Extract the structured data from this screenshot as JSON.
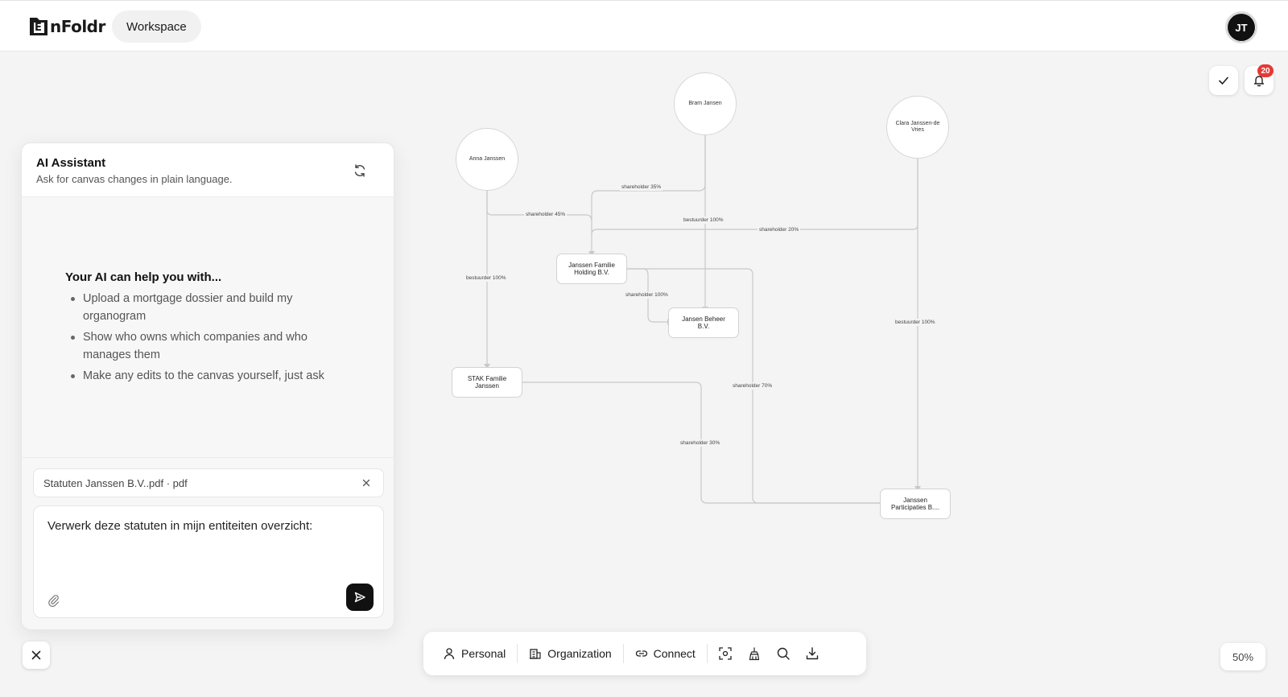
{
  "app": {
    "logo_text": "nFoldr",
    "logo_mark_letter": "E",
    "workspace_label": "Workspace",
    "user_initials": "JT"
  },
  "notifications": {
    "count": "20"
  },
  "assistant": {
    "title": "AI Assistant",
    "subtitle": "Ask for canvas changes in plain language.",
    "help_title": "Your AI can help you with...",
    "help_items": [
      "Upload a mortgage dossier and build my organogram",
      "Show who owns which companies and who manages them",
      "Make any edits to the canvas yourself, just ask"
    ],
    "attachment": "Statuten Janssen B.V..pdf · pdf",
    "input_value": "Verwerk deze statuten in mijn entiteiten overzicht:"
  },
  "toolbar": {
    "personal_label": "Personal",
    "organization_label": "Organization",
    "connect_label": "Connect"
  },
  "zoom_level": "50%",
  "graph": {
    "persons": {
      "anna": "Anna Janssen",
      "bram": "Bram Jansen",
      "clara": "Clara Janssen-de Vries"
    },
    "organizations": {
      "holding": "Janssen Familie Holding B.V.",
      "beheer": "Jansen Beheer B.V.",
      "stak": "STAK Familie Janssen",
      "participaties": "Janssen Participaties B...."
    },
    "edges": {
      "bram_holding": "shareholder 35%",
      "anna_holding": "shareholder 45%",
      "bram_beheer": "bestuurder 100%",
      "clara_holding": "shareholder 20%",
      "anna_stak": "bestuurder 100%",
      "holding_beheer": "shareholder 100%",
      "clara_participaties": "bestuurder 100%",
      "holding_participaties": "shareholder 70%",
      "stak_participaties": "shareholder 30%"
    }
  }
}
